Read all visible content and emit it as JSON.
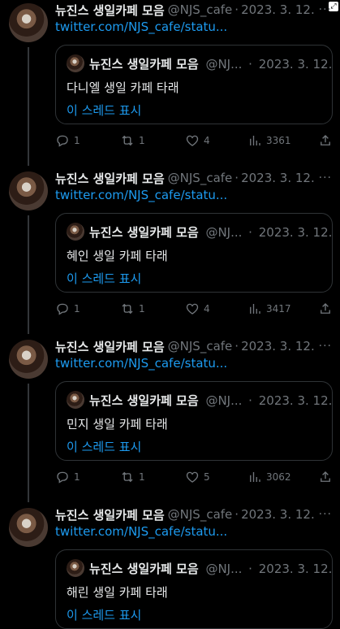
{
  "common": {
    "name": "뉴진스 생일카페 모음",
    "handle": "@NJS_cafe",
    "handle_short": "@NJ...",
    "dot": "·",
    "date": "2023. 3. 12.",
    "link": "twitter.com/NJS_cafe/statu...",
    "show_thread": "이 스레드 표시",
    "more": "···"
  },
  "corner_badge": "⤢",
  "tweets": [
    {
      "quote_text": "다니엘 생일 카페 타래",
      "replies": "1",
      "retweets": "1",
      "likes": "4",
      "views": "3361"
    },
    {
      "quote_text": "혜인 생일 카페 타래",
      "replies": "1",
      "retweets": "1",
      "likes": "4",
      "views": "3417"
    },
    {
      "quote_text": "민지 생일 카페 타래",
      "replies": "1",
      "retweets": "1",
      "likes": "5",
      "views": "3062"
    },
    {
      "quote_text": "해린 생일 카페 타래"
    }
  ]
}
